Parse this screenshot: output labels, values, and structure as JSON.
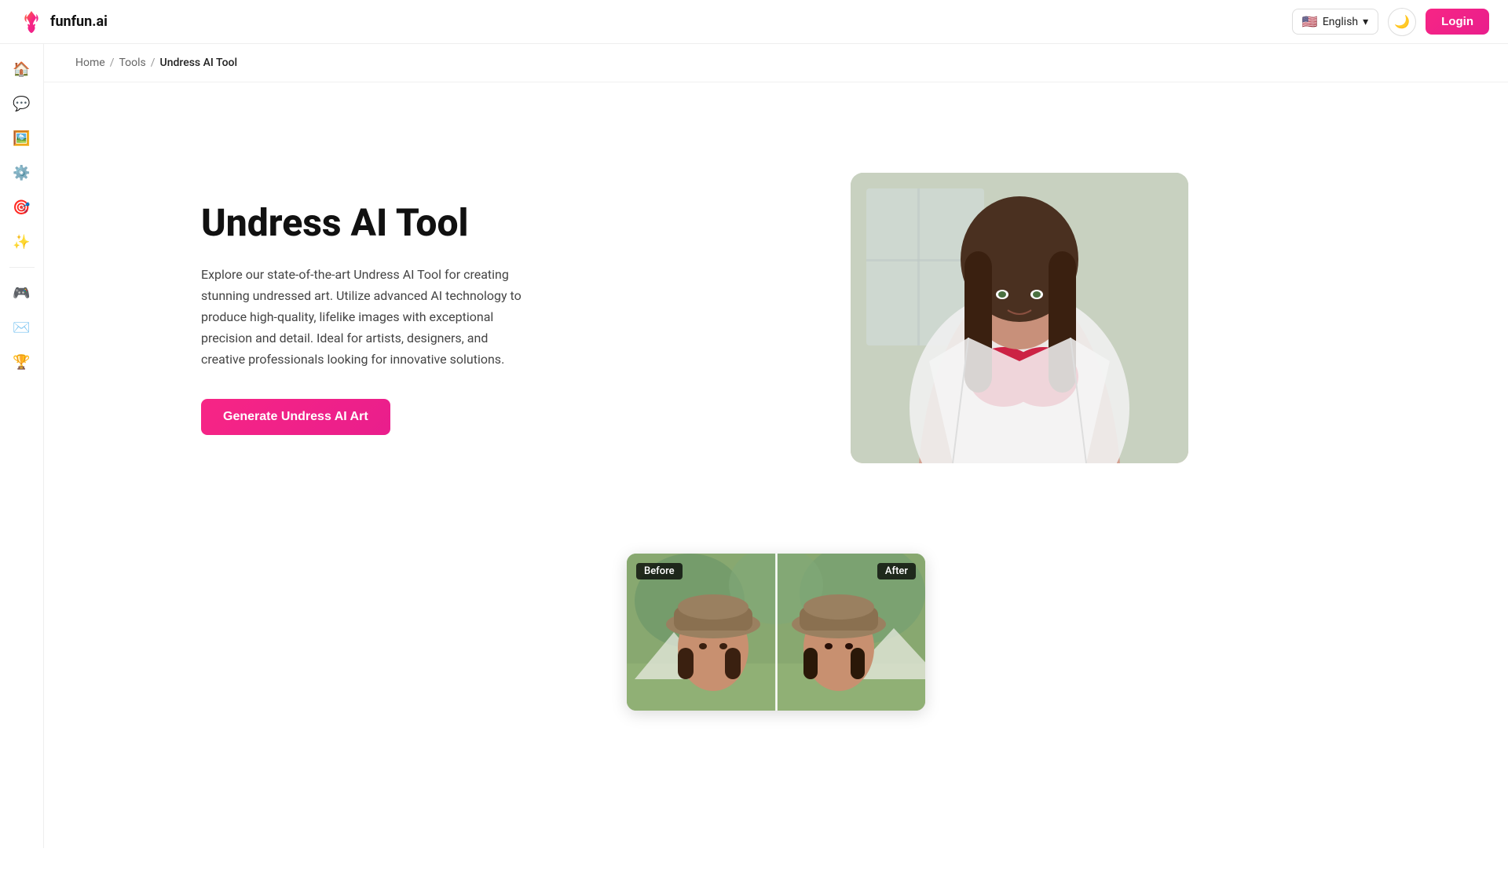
{
  "navbar": {
    "logo_text": "funfun.ai",
    "lang_flag": "🇺🇸",
    "lang_label": "English",
    "theme_icon": "🌙",
    "login_label": "Login"
  },
  "sidebar": {
    "items": [
      {
        "icon": "🏠",
        "label": "home",
        "name": "home-icon"
      },
      {
        "icon": "💬",
        "label": "chat",
        "name": "chat-icon"
      },
      {
        "icon": "🖼️",
        "label": "gallery",
        "name": "gallery-icon"
      },
      {
        "icon": "⚙️",
        "label": "settings",
        "name": "settings-icon"
      },
      {
        "icon": "🎯",
        "label": "target",
        "name": "target-icon"
      },
      {
        "icon": "✨",
        "label": "magic",
        "name": "magic-icon"
      },
      {
        "icon": "🎮",
        "label": "discord",
        "name": "discord-icon"
      },
      {
        "icon": "✉️",
        "label": "email",
        "name": "email-icon"
      },
      {
        "icon": "🏆",
        "label": "trophy",
        "name": "trophy-icon"
      }
    ]
  },
  "breadcrumb": {
    "home": "Home",
    "tools": "Tools",
    "current": "Undress AI Tool",
    "sep1": "/",
    "sep2": "/"
  },
  "hero": {
    "title": "Undress AI Tool",
    "description": "Explore our state-of-the-art Undress AI Tool for creating stunning undressed art. Utilize advanced AI technology to produce high-quality, lifelike images with exceptional precision and detail. Ideal for artists, designers, and creative professionals looking for innovative solutions.",
    "cta_label": "Generate Undress AI Art"
  },
  "before_after": {
    "before_label": "Before",
    "after_label": "After"
  }
}
